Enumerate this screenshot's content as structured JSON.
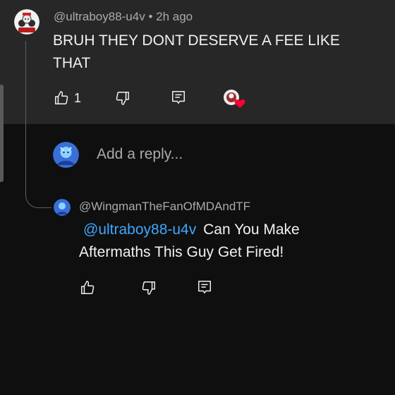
{
  "top_comment": {
    "author": "@ultraboy88-u4v",
    "separator": "•",
    "time": "2h ago",
    "text": "BRUH THEY DONT DESERVE A FEE LIKE THAT",
    "like_count": "1",
    "like_icon": "thumb-up-icon",
    "dislike_icon": "thumb-down-icon",
    "reply_icon": "comment-icon",
    "creator_heart": "creator-heart-icon"
  },
  "reply_box": {
    "placeholder": "Add a reply..."
  },
  "reply": {
    "author": "@WingmanTheFanOfMDAndTF",
    "mention": "@ultraboy88-u4v",
    "text": "Can You Make Aftermaths This Guy Get Fired!"
  },
  "colors": {
    "background": "#0f0f0f",
    "highlight": "#272727",
    "mention": "#3ea6ff",
    "secondary_text": "#aaaaaa",
    "heart": "#ff0033"
  }
}
